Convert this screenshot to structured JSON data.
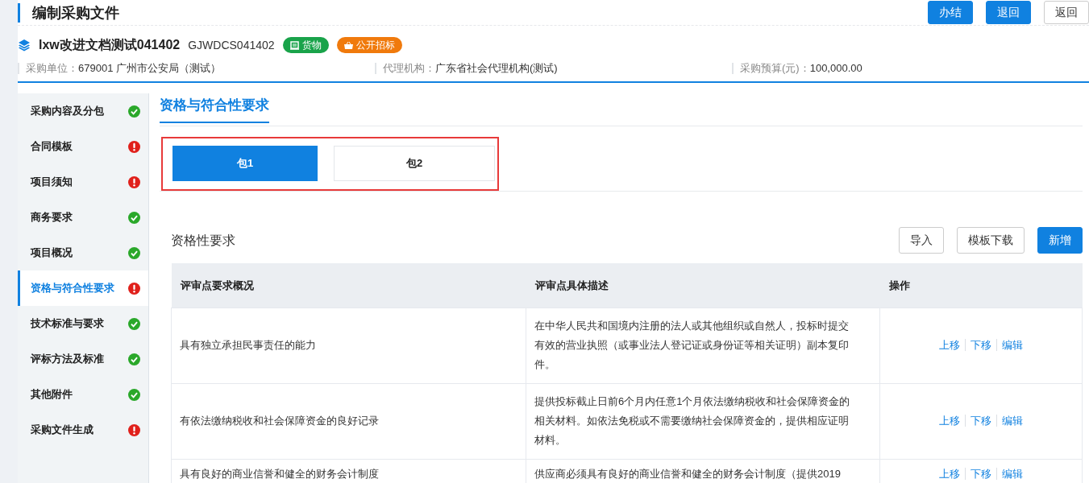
{
  "page": {
    "title": "编制采购文件",
    "buttons": [
      {
        "label": "办结",
        "kind": "primary"
      },
      {
        "label": "退回",
        "kind": "primary"
      },
      {
        "label": "返回",
        "kind": "outline"
      }
    ]
  },
  "project": {
    "name": "lxw改进文档测试041402",
    "code": "GJWDCS041402",
    "tags": [
      {
        "label": "货物",
        "kind": "goods",
        "color": "#19a34a"
      },
      {
        "label": "公开招标",
        "kind": "tender",
        "color": "#f07a0c"
      }
    ],
    "info": [
      {
        "label": "采购单位：",
        "value": "679001 广州市公安局（测试）"
      },
      {
        "label": "代理机构：",
        "value": "广东省社会代理机构(测试)"
      },
      {
        "label": "采购预算(元)：",
        "value": "100,000.00"
      }
    ]
  },
  "sidebar": {
    "items": [
      {
        "label": "采购内容及分包",
        "complete": true,
        "selected": false
      },
      {
        "label": "合同模板",
        "complete": false,
        "selected": false
      },
      {
        "label": "项目须知",
        "complete": false,
        "selected": false
      },
      {
        "label": "商务要求",
        "complete": true,
        "selected": false
      },
      {
        "label": "项目概况",
        "complete": true,
        "selected": false
      },
      {
        "label": "资格与符合性要求",
        "complete": false,
        "selected": true
      },
      {
        "label": "技术标准与要求",
        "complete": true,
        "selected": false
      },
      {
        "label": "评标方法及标准",
        "complete": true,
        "selected": false
      },
      {
        "label": "其他附件",
        "complete": true,
        "selected": false
      },
      {
        "label": "采购文件生成",
        "complete": false,
        "selected": false
      }
    ]
  },
  "section": {
    "title": "资格与符合性要求"
  },
  "tabs": [
    {
      "label": "包1",
      "selected": true
    },
    {
      "label": "包2",
      "selected": false
    }
  ],
  "panel": {
    "title": "资格性要求",
    "buttons": [
      {
        "label": "导入",
        "kind": "outline"
      },
      {
        "label": "模板下载",
        "kind": "outline"
      },
      {
        "label": "新增",
        "kind": "primary"
      }
    ]
  },
  "table": {
    "columns": [
      "评审点要求概况",
      "评审点具体描述",
      "操作"
    ],
    "rows": [
      {
        "summary": "具有独立承担民事责任的能力",
        "description": "在中华人民共和国境内注册的法人或其他组织或自然人，投标时提交有效的营业执照（或事业法人登记证或身份证等相关证明）副本复印件。",
        "actions": [
          "上移",
          "下移",
          "编辑"
        ]
      },
      {
        "summary": "有依法缴纳税收和社会保障资金的良好记录",
        "description": "提供投标截止日前6个月内任意1个月依法缴纳税收和社会保障资金的相关材料。如依法免税或不需要缴纳社会保障资金的，提供相应证明材料。",
        "actions": [
          "上移",
          "下移",
          "编辑"
        ]
      },
      {
        "summary": "具有良好的商业信誉和健全的财务会计制度",
        "description": "供应商必须具有良好的商业信誉和健全的财务会计制度（提供2019",
        "actions": [
          "上移",
          "下移",
          "编辑"
        ]
      }
    ]
  }
}
